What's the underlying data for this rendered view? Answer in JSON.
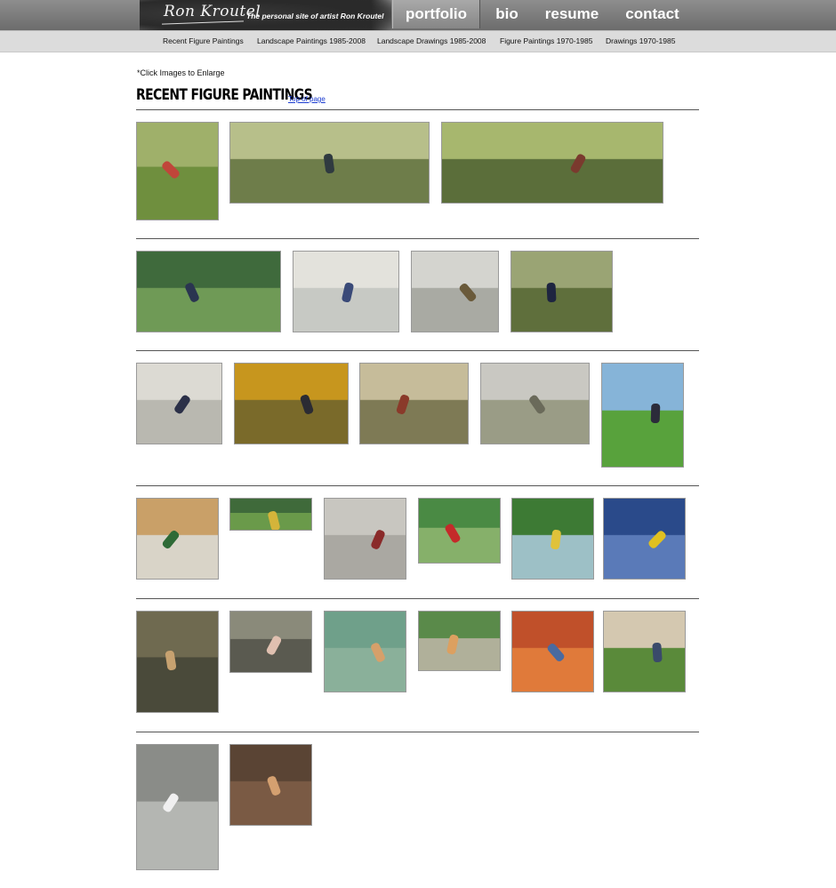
{
  "site": {
    "signature": "Ron Kroutel",
    "tagline": "The personal site of artist Ron Kroutel"
  },
  "main_nav": {
    "portfolio": "portfolio",
    "bio": "bio",
    "resume": "resume",
    "contact": "contact"
  },
  "sub_nav": [
    "Recent Figure Paintings",
    "Landscape Paintings 1985-2008",
    "Landscape Drawings 1985-2008",
    "Figure Paintings 1970-1985",
    "Drawings 1970-1985"
  ],
  "content": {
    "hint": "*Click Images to Enlarge",
    "section_title": "RECENT FIGURE PAINTINGS",
    "top_link": "Top of page"
  },
  "colors": {
    "header": "#7a7a7a",
    "subnav": "#dcdcdc",
    "link": "#1a3bd0"
  }
}
